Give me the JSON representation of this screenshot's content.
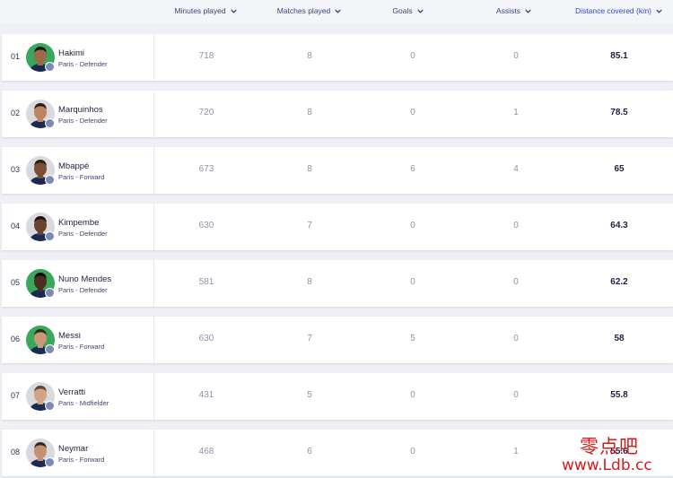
{
  "columns": [
    {
      "label": "Minutes played",
      "icon": "chevron-down-icon"
    },
    {
      "label": "Matches played",
      "icon": "chevron-down-icon"
    },
    {
      "label": "Goals",
      "icon": "chevron-down-icon"
    },
    {
      "label": "Assists",
      "icon": "chevron-down-icon"
    },
    {
      "label": "Distance covered (km)",
      "icon": "chevron-down-icon",
      "active": true
    }
  ],
  "colors": {
    "accent": "#2f4bd1",
    "text": "#1d2046",
    "muted": "#8f93a8",
    "background": "#eef0f6"
  },
  "players": [
    {
      "rank": "01",
      "name": "Hakimi",
      "info": "Paris - Defender",
      "minutes": "718",
      "matches": "8",
      "goals": "0",
      "assists": "0",
      "distance": "85.1",
      "avatar_bg": "#3aa85a",
      "skin": "#9a6a49",
      "hair": "#1a1410"
    },
    {
      "rank": "02",
      "name": "Marquinhos",
      "info": "Paris - Defender",
      "minutes": "720",
      "matches": "8",
      "goals": "0",
      "assists": "1",
      "distance": "78.5",
      "avatar_bg": "#d9d9de",
      "skin": "#b98563",
      "hair": "#2b1d14"
    },
    {
      "rank": "03",
      "name": "Mbappé",
      "info": "Paris - Forward",
      "minutes": "673",
      "matches": "8",
      "goals": "6",
      "assists": "4",
      "distance": "65",
      "avatar_bg": "#d9d9de",
      "skin": "#7a4f36",
      "hair": "#2a1e18"
    },
    {
      "rank": "04",
      "name": "Kimpembe",
      "info": "Paris - Defender",
      "minutes": "630",
      "matches": "7",
      "goals": "0",
      "assists": "0",
      "distance": "64.3",
      "avatar_bg": "#d9d9de",
      "skin": "#6a4330",
      "hair": "#1a120d"
    },
    {
      "rank": "05",
      "name": "Nuno Mendes",
      "info": "Paris - Defender",
      "minutes": "581",
      "matches": "8",
      "goals": "0",
      "assists": "0",
      "distance": "62.2",
      "avatar_bg": "#3aa85a",
      "skin": "#4a2e22",
      "hair": "#120c09"
    },
    {
      "rank": "06",
      "name": "Messi",
      "info": "Paris - Forward",
      "minutes": "630",
      "matches": "7",
      "goals": "5",
      "assists": "0",
      "distance": "58",
      "avatar_bg": "#3aa85a",
      "skin": "#c9977a",
      "hair": "#3a2718"
    },
    {
      "rank": "07",
      "name": "Verratti",
      "info": "Paris - Midfielder",
      "minutes": "431",
      "matches": "5",
      "goals": "0",
      "assists": "0",
      "distance": "55.8",
      "avatar_bg": "#d9d9de",
      "skin": "#d2a385",
      "hair": "#5a4636"
    },
    {
      "rank": "08",
      "name": "Neymar",
      "info": "Paris - Forward",
      "minutes": "468",
      "matches": "6",
      "goals": "0",
      "assists": "1",
      "distance": "55.6",
      "avatar_bg": "#d9d9de",
      "skin": "#c39273",
      "hair": "#3b2a1c"
    }
  ],
  "watermark": {
    "chinese": "零点吧",
    "url": "www.Ldb.cc"
  }
}
